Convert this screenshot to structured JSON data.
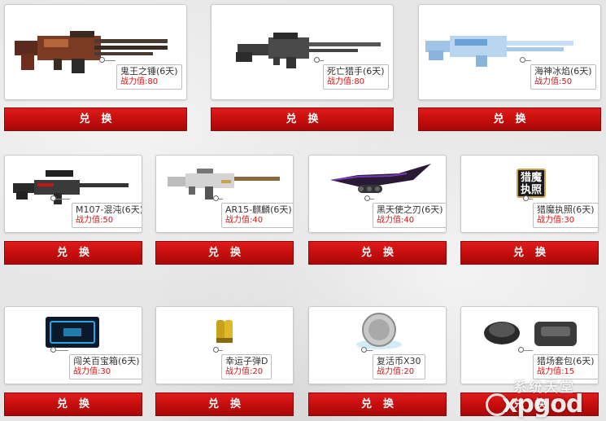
{
  "exchange_label": "兑换",
  "power_label": "战力值:",
  "items": [
    {
      "name": "鬼王之锤(6天)",
      "power": "80",
      "icon": "minigun-icon"
    },
    {
      "name": "死亡猎手(6天)",
      "power": "80",
      "icon": "heavy-rifle-icon"
    },
    {
      "name": "海神冰焰(6天)",
      "power": "50",
      "icon": "ice-cannon-icon"
    },
    {
      "name": "M107-混沌(6天)",
      "power": "50",
      "icon": "sniper-rifle-icon"
    },
    {
      "name": "AR15-麒麟(6天)",
      "power": "40",
      "icon": "assault-rifle-icon"
    },
    {
      "name": "黑天使之刃(6天)",
      "power": "40",
      "icon": "blade-icon"
    },
    {
      "name": "猎魔执照(6天)",
      "power": "30",
      "icon": "license-badge-icon"
    },
    {
      "name": "闯关百宝箱(6天)",
      "power": "30",
      "icon": "treasure-box-icon"
    },
    {
      "name": "幸运子弹D",
      "power": "20",
      "icon": "bullet-icon"
    },
    {
      "name": "复活币X30",
      "power": "20",
      "icon": "revive-coin-icon"
    },
    {
      "name": "猎场套包(6天)",
      "power": "15",
      "icon": "gear-pack-icon"
    }
  ],
  "license_badge_text": "猎魔执照",
  "watermark": {
    "cn": "系统天堂",
    "en": "xpgod"
  }
}
